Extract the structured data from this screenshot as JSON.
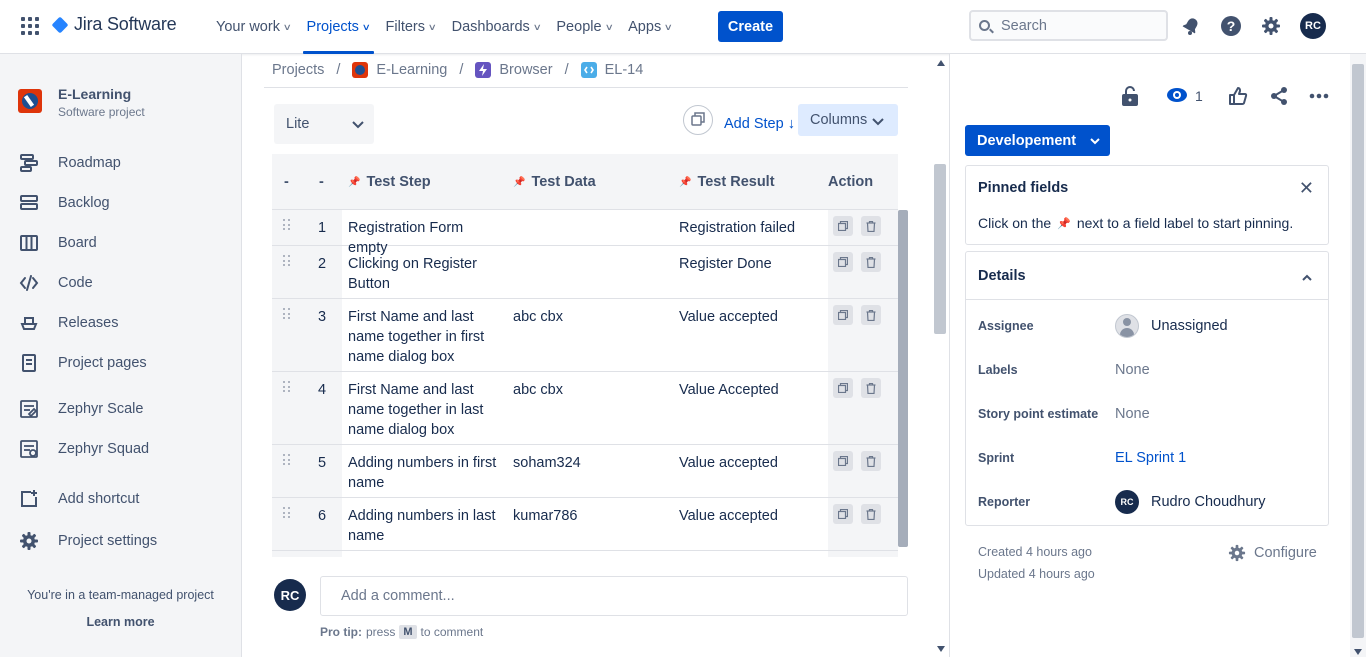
{
  "topnav": {
    "logo_text": "Jira Software",
    "items": [
      {
        "label": "Your work",
        "active": false
      },
      {
        "label": "Projects",
        "active": true
      },
      {
        "label": "Filters",
        "active": false
      },
      {
        "label": "Dashboards",
        "active": false
      },
      {
        "label": "People",
        "active": false
      },
      {
        "label": "Apps",
        "active": false
      }
    ],
    "create_label": "Create",
    "search_placeholder": "Search",
    "avatar_initials": "RC"
  },
  "sidebar": {
    "project_name": "E-Learning",
    "project_type": "Software project",
    "items": [
      {
        "label": "Roadmap",
        "icon": "roadmap-icon"
      },
      {
        "label": "Backlog",
        "icon": "backlog-icon"
      },
      {
        "label": "Board",
        "icon": "board-icon"
      },
      {
        "label": "Code",
        "icon": "code-icon"
      },
      {
        "label": "Releases",
        "icon": "releases-icon"
      },
      {
        "label": "Project pages",
        "icon": "project-pages-icon"
      },
      {
        "label": "Zephyr Scale",
        "icon": "zephyr-scale-icon"
      },
      {
        "label": "Zephyr Squad",
        "icon": "zephyr-squad-icon"
      },
      {
        "label": "Add shortcut",
        "icon": "add-shortcut-icon"
      },
      {
        "label": "Project settings",
        "icon": "gear-icon"
      }
    ],
    "footer_text": "You're in a team-managed project",
    "learn_more": "Learn more"
  },
  "breadcrumbs": {
    "projects": "Projects",
    "project": "E-Learning",
    "parent": "Browser",
    "issue": "EL-14"
  },
  "toolbar": {
    "view_mode": "Lite",
    "add_step": "Add Step",
    "columns": "Columns"
  },
  "table": {
    "headers": {
      "drag": "-",
      "num": "-",
      "step": "Test Step",
      "data": "Test Data",
      "result": "Test Result",
      "action": "Action"
    },
    "rows": [
      {
        "num": "1",
        "step": "Registration Form empty",
        "data": "",
        "result": "Registration failed"
      },
      {
        "num": "2",
        "step": "Clicking on Register Button",
        "data": "",
        "result": "Register Done"
      },
      {
        "num": "3",
        "step": "First Name and last name together in first name dialog box",
        "data": "abc cbx",
        "result": "Value accepted"
      },
      {
        "num": "4",
        "step": "First Name and last name together in last name dialog box",
        "data": "abc cbx",
        "result": "Value Accepted"
      },
      {
        "num": "5",
        "step": "Adding numbers in first name",
        "data": "soham324",
        "result": "Value accepted"
      },
      {
        "num": "6",
        "step": "Adding numbers in last name",
        "data": "kumar786",
        "result": "Value accepted"
      }
    ]
  },
  "comment": {
    "avatar_initials": "RC",
    "placeholder": "Add a comment...",
    "protip_label": "Pro tip:",
    "protip_press": "press",
    "protip_key": "M",
    "protip_suffix": "to comment"
  },
  "right_panel": {
    "watch_count": "1",
    "status": "Developement",
    "pinned": {
      "title": "Pinned fields",
      "hint_prefix": "Click on the",
      "hint_suffix": "next to a field label to start pinning."
    },
    "details": {
      "title": "Details",
      "fields": [
        {
          "label": "Assignee",
          "value": "Unassigned"
        },
        {
          "label": "Labels",
          "value": "None"
        },
        {
          "label": "Story point estimate",
          "value": "None"
        },
        {
          "label": "Sprint",
          "value": "EL Sprint 1"
        },
        {
          "label": "Reporter",
          "value": "Rudro Choudhury",
          "initials": "RC"
        }
      ]
    },
    "created": "Created 4 hours ago",
    "updated": "Updated 4 hours ago",
    "configure": "Configure"
  },
  "colors": {
    "brand": "#0052cc",
    "status_bg": "#0052cc",
    "sidebar_bg": "#f4f5f7"
  }
}
